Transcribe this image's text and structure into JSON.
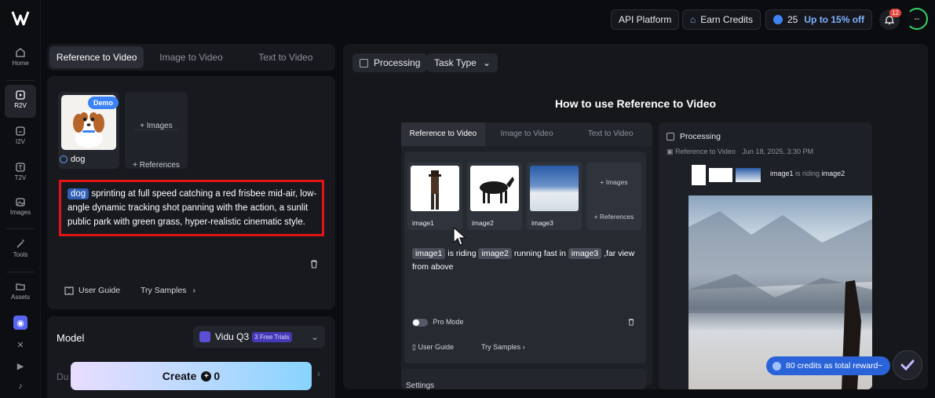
{
  "nav": {
    "items": [
      {
        "label": "Home"
      },
      {
        "label": "R2V"
      },
      {
        "label": "I2V"
      },
      {
        "label": "T2V"
      },
      {
        "label": "Images"
      },
      {
        "label": "Tools"
      },
      {
        "label": "Assets"
      }
    ],
    "social": [
      "discord-icon",
      "x-icon",
      "youtube-icon",
      "tiktok-icon"
    ]
  },
  "topbar": {
    "api_platform": "API Platform",
    "earn_credits": "Earn Credits",
    "credits": "25",
    "upto": "Up to 15% off",
    "notifications": "12",
    "avatar": "--"
  },
  "left": {
    "tabs": [
      "Reference to Video",
      "Image to Video",
      "Text to Video"
    ],
    "active_tab": "Reference to Video",
    "ref_demo_badge": "Demo",
    "ref_label": "dog",
    "add_images": "Images",
    "add_references": "References",
    "prompt_tag": "dog",
    "prompt_text": "sprinting at full speed catching a red frisbee mid-air, low-angle dynamic tracking shot panning with the action, a sunlit public park with green grass, hyper-realistic cinematic style.",
    "user_guide": "User Guide",
    "try_samples": "Try Samples",
    "model_label": "Model",
    "model_name": "Vidu Q3",
    "model_trials": "3 Free Trials",
    "create_label": "Create",
    "create_cost": "0",
    "partial_label": "Du"
  },
  "right": {
    "processing": "Processing",
    "task_type": "Task Type",
    "title": "How to use Reference to Video",
    "demo": {
      "tabs": [
        "Reference to Video",
        "Image to Video",
        "Text to Video"
      ],
      "images": [
        "image1",
        "image2",
        "image3"
      ],
      "add_images": "Images",
      "add_references": "References",
      "prompt": {
        "tag1": "image1",
        "t1": "is riding",
        "tag2": "image2",
        "t2": "running fast in",
        "tag3": "image3",
        "t3": ",far view from above"
      },
      "pro_mode": "Pro Mode",
      "user_guide": "User Guide",
      "try_samples": "Try Samples",
      "settings": "Settings",
      "right_processing": "Processing",
      "history_title": "Reference to Video",
      "history_date": "Jun 18, 2025, 3:30 PM",
      "history_tag1": "image1",
      "history_text": "is riding",
      "history_tag2": "image2"
    },
    "reward": "80 credits as total reward~"
  }
}
